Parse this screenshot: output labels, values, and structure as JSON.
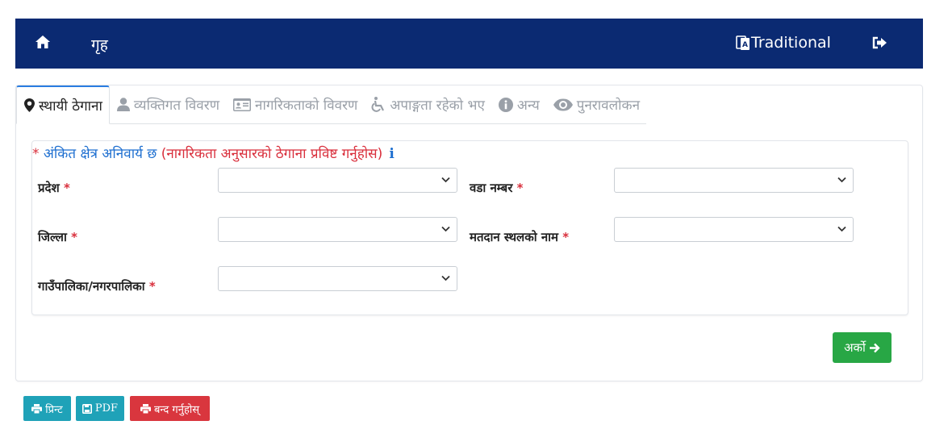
{
  "header": {
    "home_label": "गृह",
    "language_label": "Traditional"
  },
  "tabs": [
    {
      "label": "स्थायी ठेगाना",
      "icon": "map-marker-icon",
      "active": true
    },
    {
      "label": "व्यक्तिगत विवरण",
      "icon": "user-icon",
      "active": false
    },
    {
      "label": "नागरिकताको विवरण",
      "icon": "id-card-icon",
      "active": false
    },
    {
      "label": "अपाङ्गता रहेको भए",
      "icon": "wheelchair-icon",
      "active": false
    },
    {
      "label": "अन्य",
      "icon": "info-circle-icon",
      "active": false
    },
    {
      "label": "पुनरावलोकन",
      "icon": "eye-icon",
      "active": false
    }
  ],
  "form": {
    "notice_star": "*",
    "notice_blue": " अंकित क्षेत्र अनिवार्य छ",
    "notice_red": " (नागरिकता अनुसारको ठेगाना प्रविष्ट गर्नुहोस)",
    "notice_info": "i",
    "required_mark": "*",
    "fields": {
      "province": {
        "label": "प्रदेश",
        "value": ""
      },
      "district": {
        "label": "जिल्ला",
        "value": ""
      },
      "municipality": {
        "label": "गाउँपालिका/नगरपालिका",
        "value": ""
      },
      "ward": {
        "label": "वडा नम्बर",
        "value": ""
      },
      "polling_station": {
        "label": "मतदान स्थलको नाम",
        "value": ""
      }
    },
    "next_label": "अर्को"
  },
  "footer": {
    "print_label": "प्रिन्ट",
    "pdf_label": "PDF",
    "close_label": "बन्द गर्नुहोस्"
  },
  "colors": {
    "navbar": "#0b2a72",
    "active_tab_border": "#2a7de1",
    "required": "#d92f3c",
    "notice_blue": "#1e6fd0",
    "next_button": "#28a745",
    "teal_button": "#1fa2b8",
    "close_button": "#d9363e"
  }
}
